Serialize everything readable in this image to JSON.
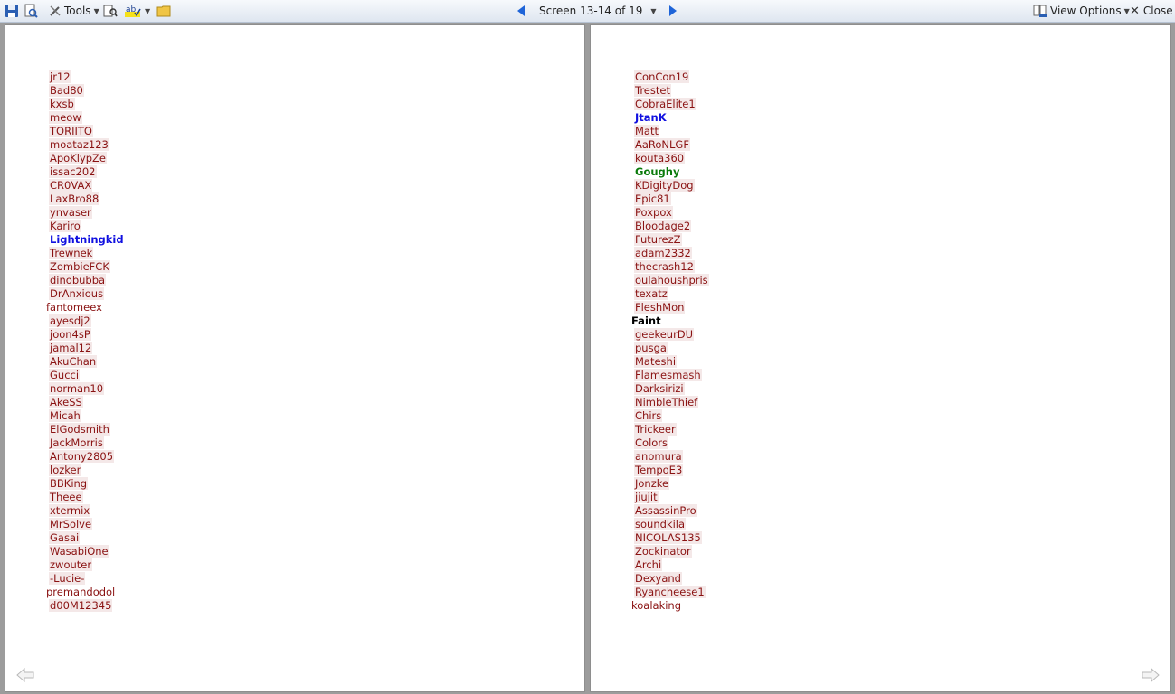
{
  "toolbar": {
    "tools_label": "Tools",
    "nav_label": "Screen 13-14 of 19",
    "view_options_label": "View Options",
    "close_label": "Close"
  },
  "left_page": {
    "names": [
      {
        "text": "jr12",
        "style": "indent"
      },
      {
        "text": "Bad80",
        "style": "indent"
      },
      {
        "text": "kxsb",
        "style": "indent"
      },
      {
        "text": "meow",
        "style": "indent"
      },
      {
        "text": "TORIITO",
        "style": "indent"
      },
      {
        "text": "moataz123",
        "style": "indent"
      },
      {
        "text": "ApoKlypZe",
        "style": "indent"
      },
      {
        "text": "issac202",
        "style": "indent"
      },
      {
        "text": "CR0VAX",
        "style": "indent"
      },
      {
        "text": "LaxBro88",
        "style": "indent"
      },
      {
        "text": "ynvaser",
        "style": "indent"
      },
      {
        "text": "Kariro",
        "style": "indent"
      },
      {
        "text": "Lightningkid",
        "style": "blue"
      },
      {
        "text": "Trewnek",
        "style": "indent"
      },
      {
        "text": "ZombieFCK",
        "style": "indent"
      },
      {
        "text": "dinobubba",
        "style": "indent"
      },
      {
        "text": "DrAnxious",
        "style": "indent"
      },
      {
        "text": "fantomeex",
        "style": "noindent"
      },
      {
        "text": "ayesdj2",
        "style": "indent"
      },
      {
        "text": "joon4sP",
        "style": "indent"
      },
      {
        "text": "jamal12",
        "style": "indent"
      },
      {
        "text": "AkuChan",
        "style": "indent"
      },
      {
        "text": "Gucci",
        "style": "indent"
      },
      {
        "text": "norman10",
        "style": "indent"
      },
      {
        "text": "AkeSS",
        "style": "indent"
      },
      {
        "text": "Micah",
        "style": "indent"
      },
      {
        "text": "ElGodsmith",
        "style": "indent"
      },
      {
        "text": "JackMorris",
        "style": "indent"
      },
      {
        "text": "Antony2805",
        "style": "indent"
      },
      {
        "text": "lozker",
        "style": "indent"
      },
      {
        "text": "BBKing",
        "style": "indent"
      },
      {
        "text": "Theee",
        "style": "indent"
      },
      {
        "text": "xtermix",
        "style": "indent"
      },
      {
        "text": "MrSolve",
        "style": "indent"
      },
      {
        "text": "Gasai",
        "style": "indent"
      },
      {
        "text": "WasabiOne",
        "style": "indent"
      },
      {
        "text": "zwouter",
        "style": "indent"
      },
      {
        "text": "-Lucie-",
        "style": "indent"
      },
      {
        "text": "premandodol",
        "style": "noindent"
      },
      {
        "text": "d00M12345",
        "style": "indent"
      }
    ]
  },
  "right_page": {
    "names": [
      {
        "text": "ConCon19",
        "style": "indent"
      },
      {
        "text": "Trestet",
        "style": "indent"
      },
      {
        "text": "CobraElite1",
        "style": "indent"
      },
      {
        "text": "JtanK",
        "style": "blue"
      },
      {
        "text": "Matt",
        "style": "indent"
      },
      {
        "text": "AaRoNLGF",
        "style": "indent"
      },
      {
        "text": "kouta360",
        "style": "indent"
      },
      {
        "text": "Goughy",
        "style": "green"
      },
      {
        "text": "KDigityDog",
        "style": "indent"
      },
      {
        "text": "Epic81",
        "style": "indent"
      },
      {
        "text": "Poxpox",
        "style": "indent"
      },
      {
        "text": "Bloodage2",
        "style": "indent"
      },
      {
        "text": "FuturezZ",
        "style": "indent"
      },
      {
        "text": "adam2332",
        "style": "indent"
      },
      {
        "text": "thecrash12",
        "style": "indent"
      },
      {
        "text": "oulahoushpris",
        "style": "indent"
      },
      {
        "text": "texatz",
        "style": "indent"
      },
      {
        "text": "FleshMon",
        "style": "indent"
      },
      {
        "text": "Faint",
        "style": "black"
      },
      {
        "text": "geekeurDU",
        "style": "indent"
      },
      {
        "text": "pusga",
        "style": "indent"
      },
      {
        "text": "Mateshi",
        "style": "indent"
      },
      {
        "text": "Flamesmash",
        "style": "indent"
      },
      {
        "text": "Darksirizi",
        "style": "indent"
      },
      {
        "text": "NimbleThief",
        "style": "indent"
      },
      {
        "text": "Chirs",
        "style": "indent"
      },
      {
        "text": "Trickeer",
        "style": "indent"
      },
      {
        "text": "Colors",
        "style": "indent"
      },
      {
        "text": "anomura",
        "style": "indent"
      },
      {
        "text": "TempoE3",
        "style": "indent"
      },
      {
        "text": "Jonzke",
        "style": "indent"
      },
      {
        "text": "jiujit",
        "style": "indent"
      },
      {
        "text": "AssassinPro",
        "style": "indent"
      },
      {
        "text": "soundkila",
        "style": "indent"
      },
      {
        "text": "NICOLAS135",
        "style": "indent"
      },
      {
        "text": "Zockinator",
        "style": "indent"
      },
      {
        "text": "Archi",
        "style": "indent"
      },
      {
        "text": "Dexyand",
        "style": "indent"
      },
      {
        "text": "Ryancheese1",
        "style": "indent"
      },
      {
        "text": "koalaking",
        "style": "noindent"
      }
    ]
  },
  "icons": [
    "save-icon",
    "print-preview-icon",
    "tools-icon",
    "research-icon",
    "spelling-icon",
    "folder-icon",
    "previous-screen-icon",
    "next-screen-icon",
    "view-options-icon",
    "close-icon",
    "page-back-arrow-icon",
    "page-forward-arrow-icon"
  ]
}
